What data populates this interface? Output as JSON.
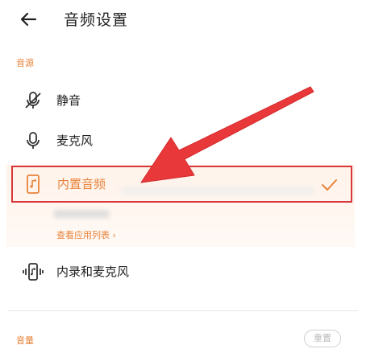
{
  "header": {
    "title": "音频设置",
    "back_icon": "arrow-left-icon"
  },
  "source_section": {
    "label": "音源"
  },
  "options": [
    {
      "label": "静音",
      "icon": "mic-off-icon"
    },
    {
      "label": "麦克风",
      "icon": "mic-icon"
    },
    {
      "label": "内置音频",
      "icon": "phone-music-icon",
      "selected": true
    },
    {
      "label": "内录和麦克风",
      "icon": "phone-vibrate-icon"
    }
  ],
  "selected_option": {
    "link_text": "查看应用列表 ›"
  },
  "volume_section": {
    "label": "音量",
    "reset_label": "重置"
  },
  "colors": {
    "accent": "#e8823a",
    "annotation_red": "#d9383a",
    "text": "#222222"
  }
}
